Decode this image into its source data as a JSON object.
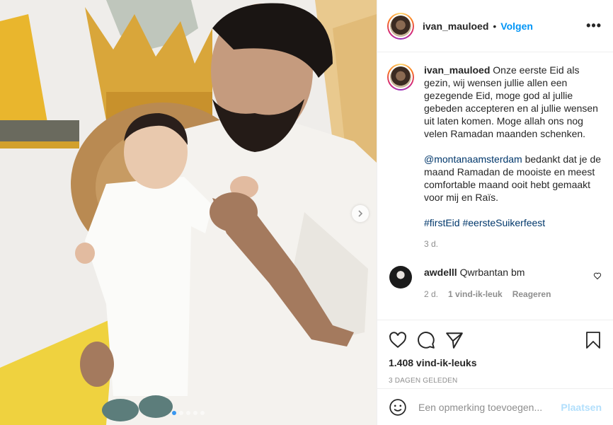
{
  "post": {
    "username": "ivan_mauloed",
    "follow_label": "Volgen",
    "separator": "•",
    "more_label": "•••"
  },
  "caption": {
    "username": "ivan_mauloed",
    "paragraph1": "Onze eerste Eid als gezin, wij wensen jullie allen een gezegende Eid, moge god al jullie gebeden accepteren en al jullie wensen uit laten komen. Moge allah ons nog velen Ramadan maanden schenken.",
    "mention": "@montanaamsterdam",
    "paragraph2": "bedankt dat je de maand Ramadan de mooiste en meest comfortable maand ooit hebt gemaakt voor mij en Raïs.",
    "hashtag1": "#firstEid",
    "hashtag2": "#eersteSuikerfeest",
    "age": "3 d."
  },
  "comments": [
    {
      "username": "awdelll",
      "text": "Qwrbantan bm",
      "age": "2 d.",
      "likes": "1 vind-ik-leuk",
      "reply_label": "Reageren"
    }
  ],
  "stats": {
    "likes": "1.408 vind-ik-leuks",
    "date": "3 DAGEN GELEDEN"
  },
  "composer": {
    "placeholder": "Een opmerking toevoegen...",
    "post_label": "Plaatsen"
  },
  "carousel": {
    "total": 5,
    "active_index": 0
  },
  "colors": {
    "accent": "#0095f6",
    "link": "#00376b",
    "muted": "#8e8e8e",
    "post_disabled": "#b2dffc"
  },
  "icons": [
    "heart-icon",
    "comment-icon",
    "share-icon",
    "bookmark-icon",
    "emoji-icon",
    "chevron-right-icon",
    "more-icon"
  ]
}
